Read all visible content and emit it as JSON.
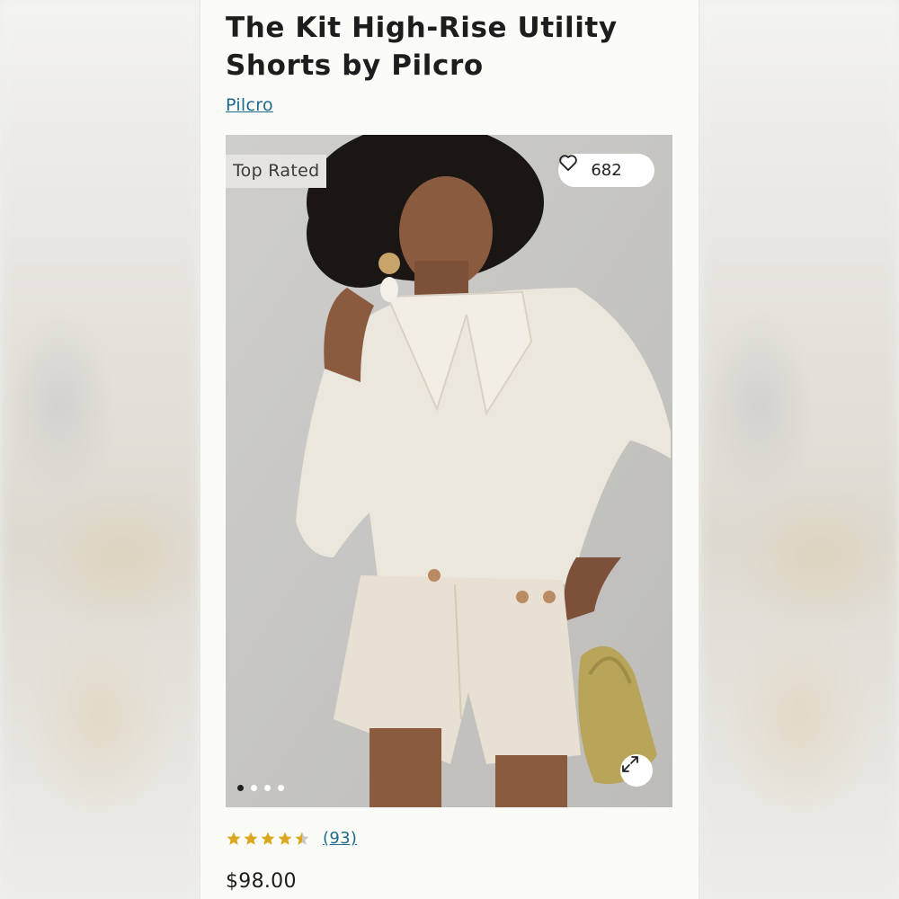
{
  "product": {
    "title": "The Kit High-Rise Utility Shorts by Pilcro",
    "brand": "Pilcro",
    "badge": "Top Rated",
    "likes": "682",
    "rating": 4.5,
    "review_count": "(93)",
    "price": "$98.00"
  },
  "gallery": {
    "slide_count": 4,
    "active_slide": 1
  },
  "icons": {
    "like": "heart-outline-icon",
    "expand": "expand-arrows-icon",
    "rating": "star-icon"
  },
  "colors": {
    "link": "#1c6a8c",
    "star": "#d9a81e",
    "star_empty": "#c9c6bf"
  }
}
